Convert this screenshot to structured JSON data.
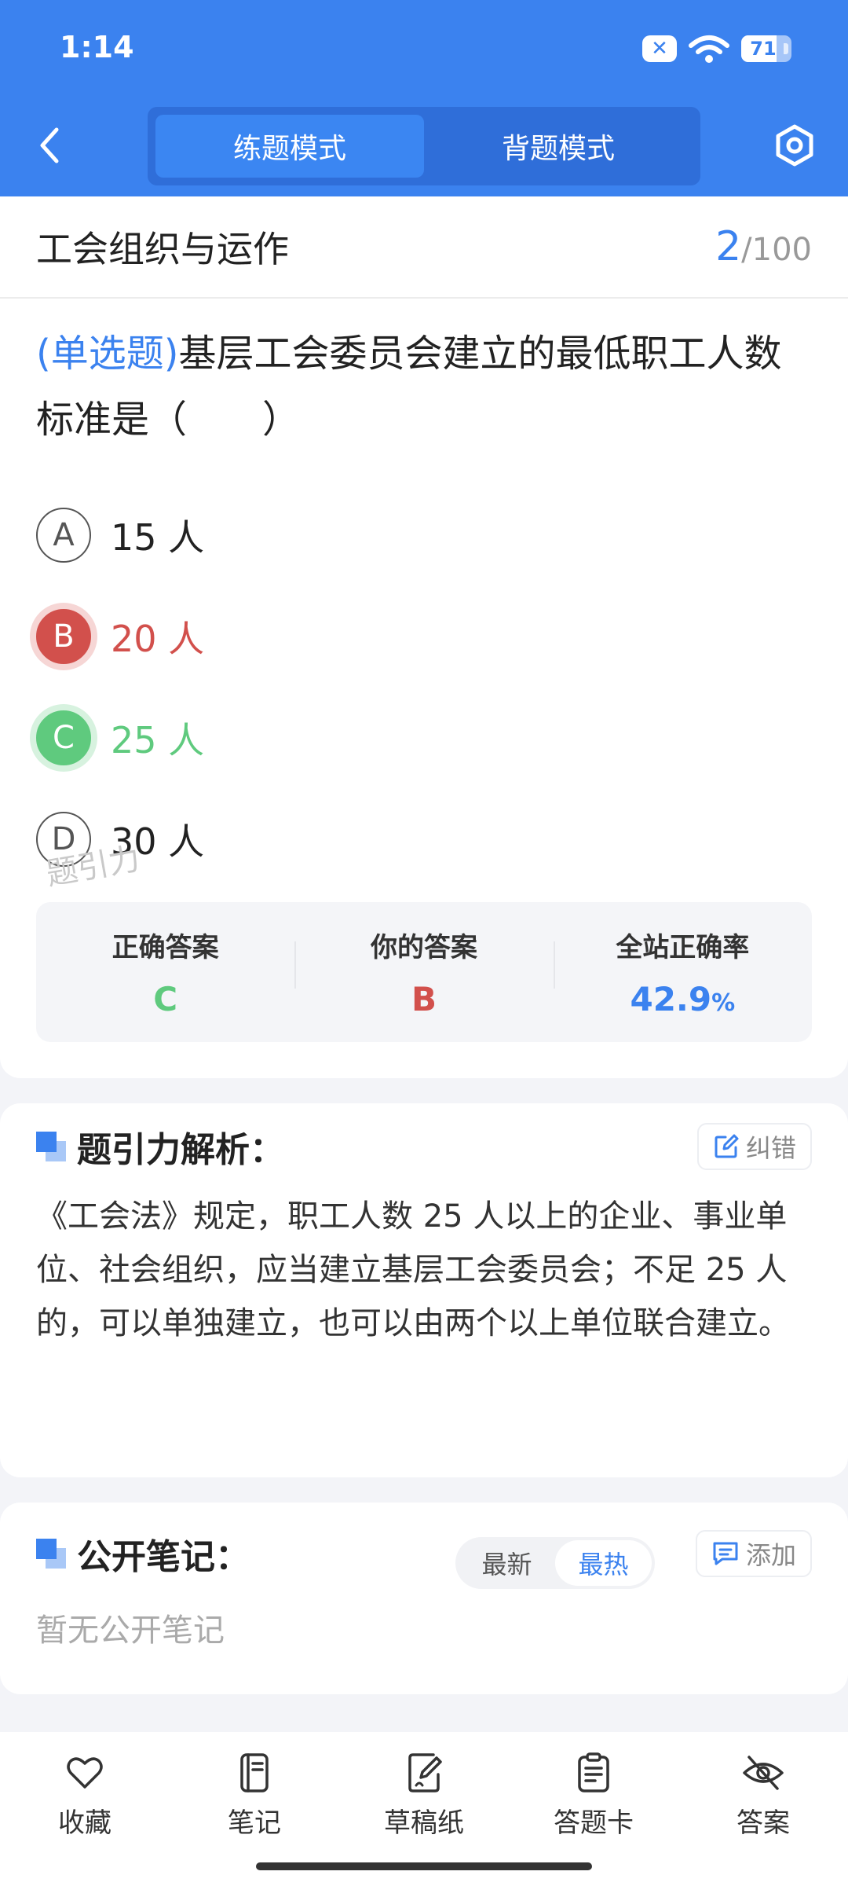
{
  "status_bar": {
    "time": "1:14",
    "battery_level": "71",
    "battery_fraction": 0.71
  },
  "header": {
    "tabs": [
      {
        "label": "练题模式",
        "active": true
      },
      {
        "label": "背题模式",
        "active": false
      }
    ]
  },
  "question": {
    "section_title": "工会组织与运作",
    "current": "2",
    "total": "/100",
    "type": "(单选题)",
    "text": "基层工会委员会建立的最低职工人数标准是（　　）",
    "options": [
      {
        "letter": "A",
        "text": "15 人",
        "state": "normal"
      },
      {
        "letter": "B",
        "text": "20 人",
        "state": "wrong"
      },
      {
        "letter": "C",
        "text": "25 人",
        "state": "right"
      },
      {
        "letter": "D",
        "text": "30 人",
        "state": "normal"
      }
    ]
  },
  "answers": {
    "correct_label": "正确答案",
    "correct_value": "C",
    "yours_label": "你的答案",
    "yours_value": "B",
    "rate_label": "全站正确率",
    "rate_value": "42.9",
    "rate_unit": "%",
    "watermark": "题引力"
  },
  "analysis": {
    "title": "题引力解析：",
    "report_label": "纠错",
    "text": "《工会法》规定，职工人数 25 人以上的企业、事业单位、社会组织，应当建立基层工会委员会；不足 25 人的，可以单独建立，也可以由两个以上单位联合建立。"
  },
  "notes": {
    "title": "公开笔记：",
    "sort_options": [
      "最新",
      "最热"
    ],
    "active_sort": "最热",
    "add_label": "添加",
    "empty_text": "暂无公开笔记"
  },
  "bottom_nav": [
    {
      "label": "收藏",
      "icon": "heart-icon"
    },
    {
      "label": "笔记",
      "icon": "notebook-icon"
    },
    {
      "label": "草稿纸",
      "icon": "draft-paper-icon"
    },
    {
      "label": "答题卡",
      "icon": "answer-sheet-icon"
    },
    {
      "label": "答案",
      "icon": "eye-off-icon"
    }
  ],
  "colors": {
    "primary": "#3b82ef",
    "wrong": "#d2504c",
    "correct": "#5fca7e"
  }
}
